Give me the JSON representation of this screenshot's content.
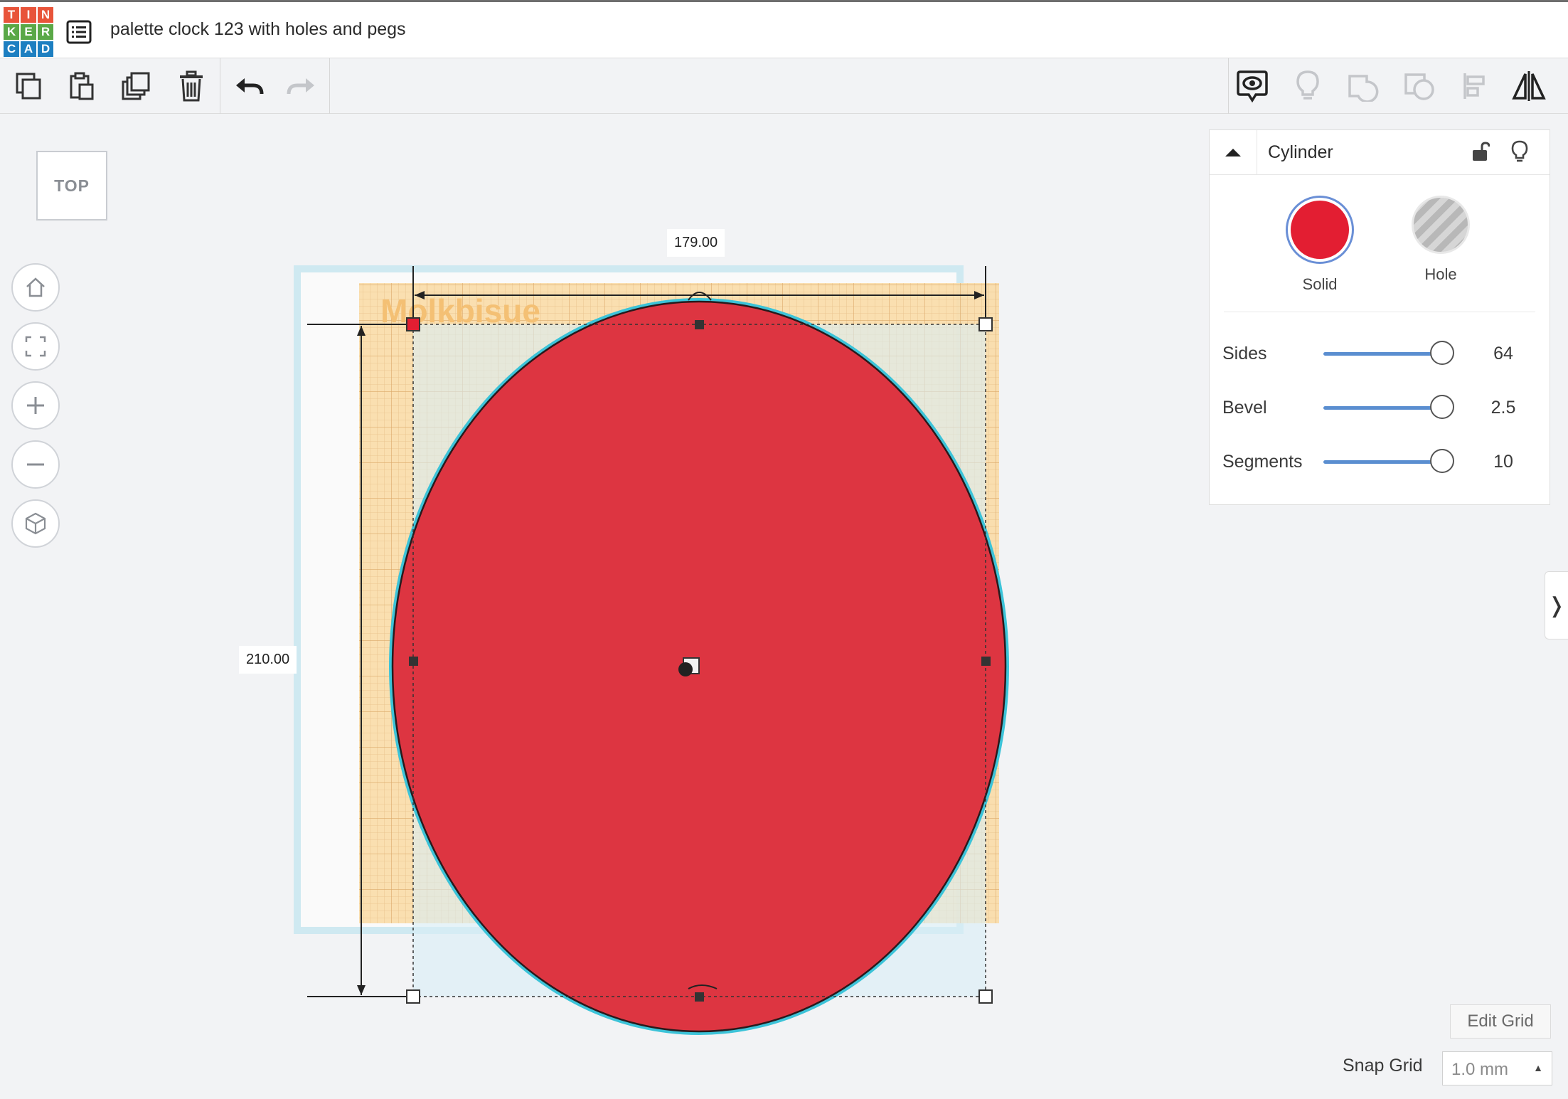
{
  "app": {
    "logo_letters": [
      "T",
      "I",
      "N",
      "K",
      "E",
      "R",
      "C",
      "A",
      "D"
    ],
    "logo_colors": [
      "#e8543a",
      "#e8543a",
      "#e8543a",
      "#5aa847",
      "#5aa847",
      "#5aa847",
      "#1d7fc1",
      "#1d7fc1",
      "#1d7fc1"
    ],
    "project_title": "palette clock 123 with holes and pegs"
  },
  "toolbar": {
    "left_tools": [
      "copy-icon",
      "paste-icon",
      "duplicate-icon",
      "delete-icon",
      "undo-icon",
      "redo-icon"
    ],
    "right_tools": [
      "show-notes-icon",
      "lightbulb-icon",
      "group-icon",
      "ungroup-icon",
      "align-icon",
      "mirror-icon"
    ]
  },
  "viewcube": {
    "label": "TOP"
  },
  "nav_controls": [
    "home-view-icon",
    "fit-view-icon",
    "zoom-in-icon",
    "zoom-out-icon",
    "orthographic-icon"
  ],
  "scene": {
    "background_text": "Molkbisue",
    "width_dimension": "179.00",
    "height_dimension": "210.00",
    "shape_color": "#dd3541",
    "outline_color": "#3cc3d8"
  },
  "inspector": {
    "title": "Cylinder",
    "solid_label": "Solid",
    "hole_label": "Hole",
    "solid_color": "#e31e32",
    "properties": [
      {
        "label": "Sides",
        "value": "64"
      },
      {
        "label": "Bevel",
        "value": "2.5"
      },
      {
        "label": "Segments",
        "value": "10"
      }
    ]
  },
  "grid": {
    "edit_grid_label": "Edit Grid",
    "snap_grid_label": "Snap Grid",
    "snap_grid_value": "1.0 mm"
  },
  "side_tab": {
    "glyph": "❭"
  }
}
